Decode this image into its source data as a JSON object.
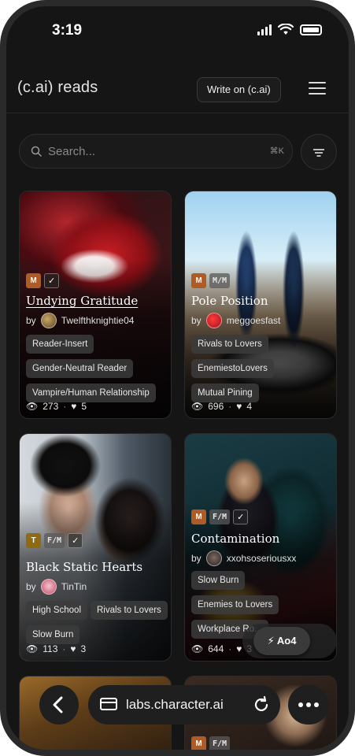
{
  "status_bar": {
    "time": "3:19"
  },
  "header": {
    "brand": "(c.ai) reads",
    "write_label": "Write on (c.ai)"
  },
  "search": {
    "placeholder": "Search...",
    "shortcut": "⌘K"
  },
  "cards": [
    {
      "rating": "M",
      "category": "",
      "title": "Undying Gratitude",
      "author": "Twelfthknightie04",
      "tags": [
        "Reader-Insert",
        "Gender-Neutral Reader",
        "Vampire/Human Relationship"
      ],
      "views": "273",
      "likes": "5"
    },
    {
      "rating": "M",
      "category": "M/M",
      "title": "Pole Position",
      "author": "meggoesfast",
      "tags": [
        "Rivals to Lovers",
        "EnemiestoLovers",
        "Mutual Pining"
      ],
      "views": "696",
      "likes": "4"
    },
    {
      "rating": "T",
      "category": "F/M",
      "title": "Black Static Hearts",
      "author": "TinTin",
      "tags": [
        "High School",
        "Rivals to Lovers",
        "Slow Burn"
      ],
      "views": "113",
      "likes": "3"
    },
    {
      "rating": "M",
      "category": "F/M",
      "title": "Contamination",
      "author": "xxohsoseriousxx",
      "tags": [
        "Slow Burn",
        "Enemies to Lovers",
        "Workplace Ro..."
      ],
      "views": "644",
      "likes": "3"
    },
    {
      "rating": "",
      "category": ""
    },
    {
      "rating": "M",
      "category": "F/M"
    }
  ],
  "floating": {
    "ao4_label": "Ao4"
  },
  "browser": {
    "url": "labs.character.ai"
  }
}
